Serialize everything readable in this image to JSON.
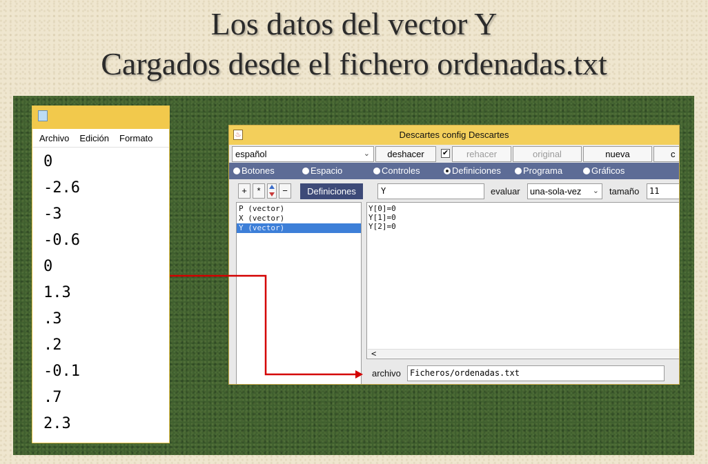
{
  "slide": {
    "title_line1": "Los datos del vector Y",
    "title_line2": "Cargados desde el fichero ordenadas.txt"
  },
  "notepad": {
    "menu": [
      "Archivo",
      "Edición",
      "Formato"
    ],
    "lines": [
      "0",
      "-2.6",
      "-3",
      "-0.6",
      "0",
      "1.3",
      ".3",
      ".2",
      "-0.1",
      ".7",
      "2.3"
    ]
  },
  "descartes": {
    "title": "Descartes config Descartes",
    "toolbar": {
      "language": "español",
      "undo": "deshacer",
      "redo": "rehacer",
      "original": "original",
      "new": "nueva",
      "cut_off": "c"
    },
    "tabs": [
      {
        "label": "Botones",
        "selected": false
      },
      {
        "label": "Espacio",
        "selected": false
      },
      {
        "label": "Controles",
        "selected": false
      },
      {
        "label": "Definiciones",
        "selected": true
      },
      {
        "label": "Programa",
        "selected": false
      },
      {
        "label": "Gráficos",
        "selected": false
      }
    ],
    "left": {
      "plus": "+",
      "star": "*",
      "minus": "−",
      "section_label": "Definiciones",
      "items": [
        "P (vector)",
        "X (vector)",
        "Y (vector)"
      ],
      "selected_index": 2
    },
    "right": {
      "name_value": "Y",
      "evaluate_label": "evaluar",
      "evaluate_value": "una-sola-vez",
      "size_label": "tamaño",
      "size_value": "11",
      "values": [
        "Y[0]=0",
        "Y[1]=0",
        "Y[2]=0"
      ],
      "scroll_arrow": "<",
      "file_label": "archivo",
      "file_value": "Ficheros/ordenadas.txt"
    }
  },
  "colors": {
    "arrow": "#d40000",
    "titlebar": "#f3cf5b",
    "tab_bar": "#5d6c96",
    "selected_item": "#3d7fd8"
  }
}
